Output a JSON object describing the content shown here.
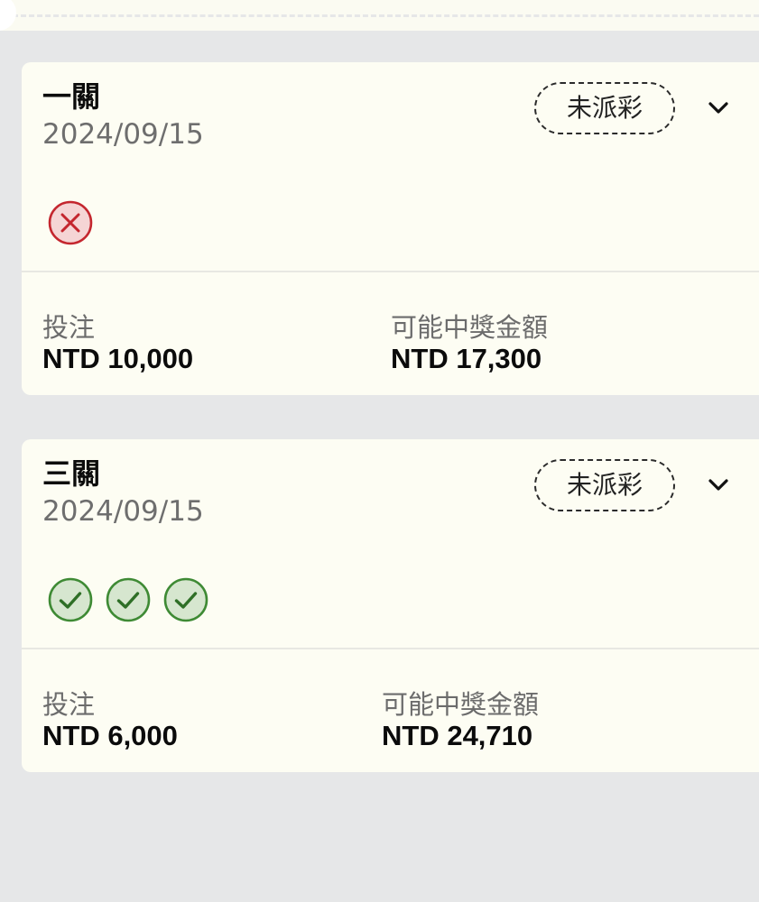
{
  "bets": [
    {
      "type": "一關",
      "date": "2024/09/15",
      "status": "未派彩",
      "legs": [
        "lost"
      ],
      "stake_label": "投注",
      "stake_value": "NTD 10,000",
      "payout_label": "可能中獎金額",
      "payout_value": "NTD 17,300"
    },
    {
      "type": "三關",
      "date": "2024/09/15",
      "status": "未派彩",
      "legs": [
        "won",
        "won",
        "won"
      ],
      "stake_label": "投注",
      "stake_value": "NTD 6,000",
      "payout_label": "可能中獎金額",
      "payout_value": "NTD 24,710"
    }
  ],
  "icons": {
    "expand": "chevron-down-icon",
    "lost": "cross-circle-icon",
    "won": "check-circle-icon"
  },
  "colors": {
    "lost": "#c4262e",
    "won": "#3e8a34",
    "card_bg": "#fdfdf3",
    "page_bg": "#e6e7e8"
  }
}
